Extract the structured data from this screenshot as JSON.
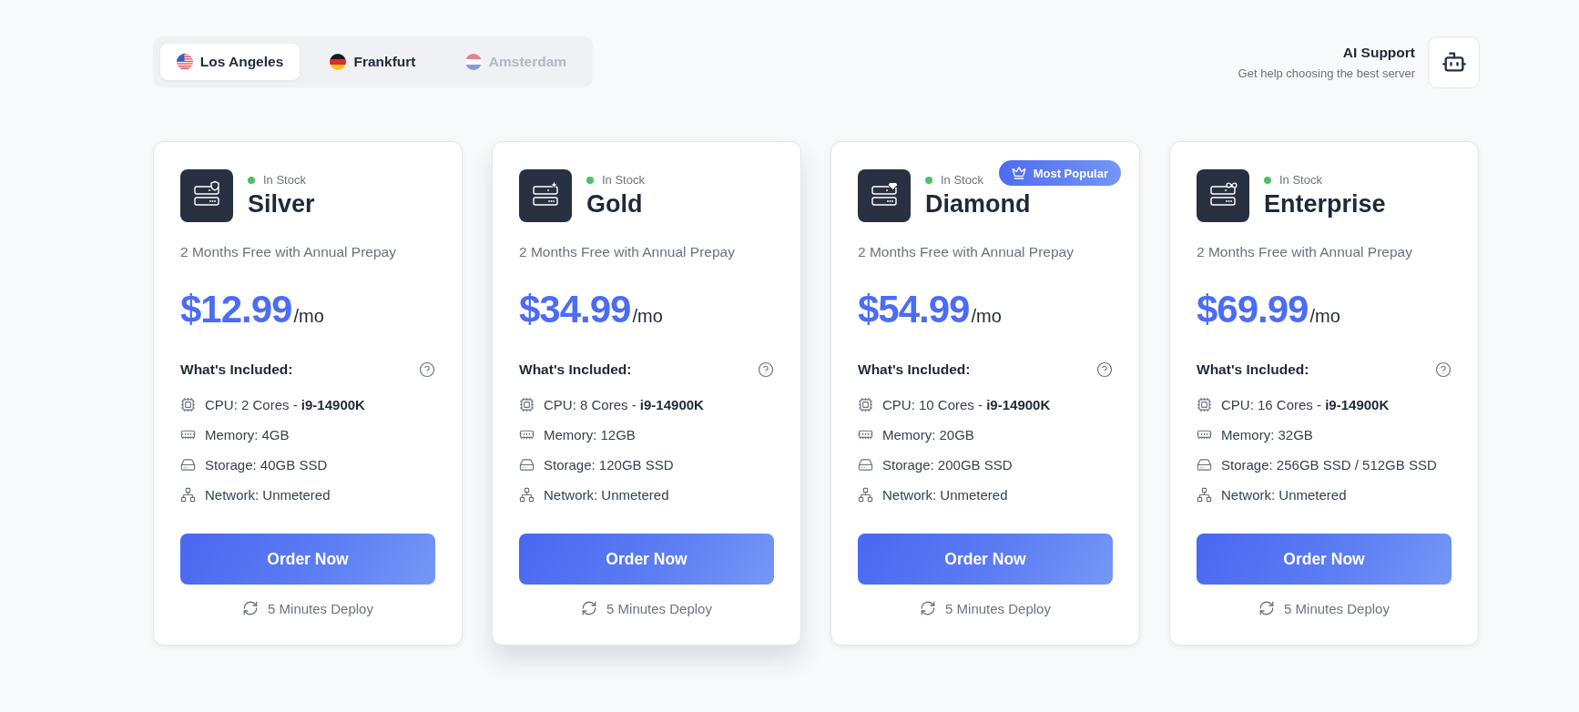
{
  "location_tabs": [
    {
      "label": "Los Angeles",
      "kind": "us",
      "selected": true,
      "disabled": false
    },
    {
      "label": "Frankfurt",
      "kind": "de",
      "selected": false,
      "disabled": false
    },
    {
      "label": "Amsterdam",
      "kind": "nl",
      "selected": false,
      "disabled": true
    }
  ],
  "ai_support": {
    "title": "AI Support",
    "subtitle": "Get help choosing the best server"
  },
  "plans": [
    {
      "kind": "shield",
      "status": "In Stock",
      "available": true,
      "name": "Silver",
      "promo": "2 Months Free with Annual Prepay",
      "price": "$12.99",
      "period": "/mo",
      "included_title": "What's Included:",
      "features": [
        {
          "kind": "cpu",
          "text": "CPU: 2 Cores - **i9-14900K**"
        },
        {
          "kind": "memory",
          "text": "Memory: 4GB"
        },
        {
          "kind": "storage",
          "text": "Storage: 40GB SSD"
        },
        {
          "kind": "network",
          "text": "Network: Unmetered"
        }
      ],
      "button": "Order Now",
      "deploy": "5 Minutes Deploy",
      "raised": false
    },
    {
      "kind": "sparkle",
      "status": "In Stock",
      "available": true,
      "name": "Gold",
      "promo": "2 Months Free with Annual Prepay",
      "price": "$34.99",
      "period": "/mo",
      "included_title": "What's Included:",
      "features": [
        {
          "kind": "cpu",
          "text": "CPU: 8 Cores - **i9-14900K**"
        },
        {
          "kind": "memory",
          "text": "Memory: 12GB"
        },
        {
          "kind": "storage",
          "text": "Storage: 120GB SSD"
        },
        {
          "kind": "network",
          "text": "Network: Unmetered"
        }
      ],
      "button": "Order Now",
      "deploy": "5 Minutes Deploy",
      "raised": true
    },
    {
      "kind": "gem",
      "status": "In Stock",
      "available": true,
      "name": "Diamond",
      "badge": "Most Popular",
      "promo": "2 Months Free with Annual Prepay",
      "price": "$54.99",
      "period": "/mo",
      "included_title": "What's Included:",
      "features": [
        {
          "kind": "cpu",
          "text": "CPU: 10 Cores - **i9-14900K**"
        },
        {
          "kind": "memory",
          "text": "Memory: 20GB"
        },
        {
          "kind": "storage",
          "text": "Storage: 200GB SSD"
        },
        {
          "kind": "network",
          "text": "Network: Unmetered"
        }
      ],
      "button": "Order Now",
      "deploy": "5 Minutes Deploy",
      "raised": false
    },
    {
      "kind": "infinity",
      "status": "In Stock",
      "available": true,
      "name": "Enterprise",
      "promo": "2 Months Free with Annual Prepay",
      "price": "$69.99",
      "period": "/mo",
      "included_title": "What's Included:",
      "features": [
        {
          "kind": "cpu",
          "text": "CPU: 16 Cores - **i9-14900K**"
        },
        {
          "kind": "memory",
          "text": "Memory: 32GB"
        },
        {
          "kind": "storage",
          "text": "Storage: 256GB SSD / 512GB SSD"
        },
        {
          "kind": "network",
          "text": "Network: Unmetered"
        }
      ],
      "button": "Order Now",
      "deploy": "5 Minutes Deploy",
      "raised": false
    }
  ]
}
